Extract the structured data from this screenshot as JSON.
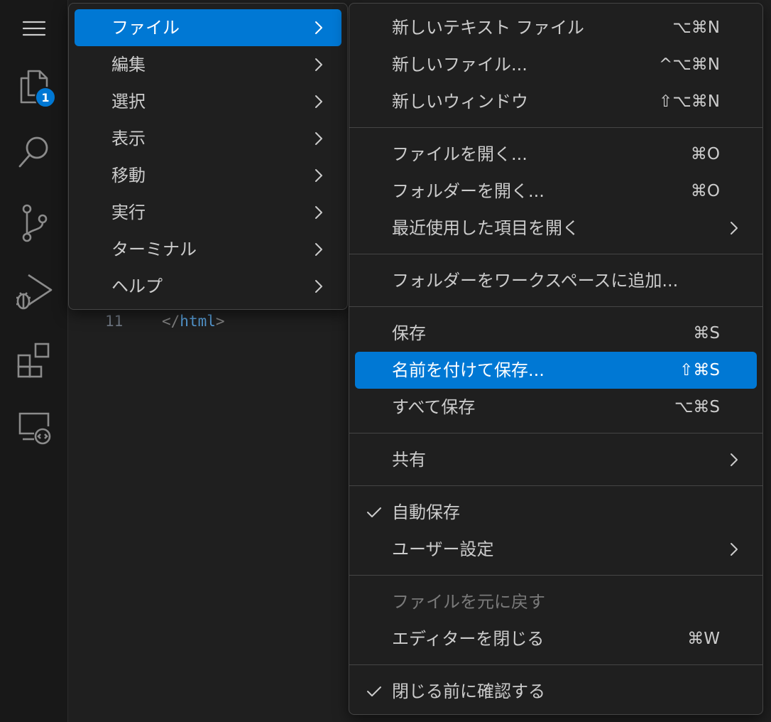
{
  "activity_bar": {
    "explorer_badge": "1",
    "icons": [
      "menu-icon",
      "files-icon",
      "search-icon",
      "source-control-icon",
      "run-debug-icon",
      "extensions-icon",
      "remote-explorer-icon"
    ]
  },
  "editor": {
    "line_number": "11",
    "code": {
      "open": "</",
      "tag": "html",
      "close": ">"
    }
  },
  "main_menu": {
    "items": [
      {
        "label": "ファイル",
        "highlighted": true
      },
      {
        "label": "編集"
      },
      {
        "label": "選択"
      },
      {
        "label": "表示"
      },
      {
        "label": "移動"
      },
      {
        "label": "実行"
      },
      {
        "label": "ターミナル"
      },
      {
        "label": "ヘルプ"
      }
    ]
  },
  "file_menu": {
    "items": [
      {
        "label": "新しいテキスト ファイル",
        "shortcut": "⌥⌘N"
      },
      {
        "label": "新しいファイル...",
        "shortcut": "^⌥⌘N"
      },
      {
        "label": "新しいウィンドウ",
        "shortcut": "⇧⌥⌘N"
      },
      {
        "label": "ファイルを開く...",
        "shortcut": "⌘O"
      },
      {
        "label": "フォルダーを開く...",
        "shortcut": "⌘O"
      },
      {
        "label": "最近使用した項目を開く",
        "submenu": true
      },
      {
        "label": "フォルダーをワークスペースに追加..."
      },
      {
        "label": "保存",
        "shortcut": "⌘S"
      },
      {
        "label": "名前を付けて保存...",
        "shortcut": "⇧⌘S",
        "highlighted": true
      },
      {
        "label": "すべて保存",
        "shortcut": "⌥⌘S"
      },
      {
        "label": "共有",
        "submenu": true
      },
      {
        "label": "自動保存",
        "checked": true
      },
      {
        "label": "ユーザー設定",
        "submenu": true
      },
      {
        "label": "ファイルを元に戻す",
        "disabled": true
      },
      {
        "label": "エディターを閉じる",
        "shortcut": "⌘W"
      },
      {
        "label": "閉じる前に確認する",
        "checked": true
      }
    ]
  },
  "colors": {
    "accent": "#0078d4",
    "menu_bg": "#1f1f1f",
    "activity_bar_bg": "#181818",
    "text": "#cccccc",
    "disabled_text": "#7a7a7a"
  }
}
